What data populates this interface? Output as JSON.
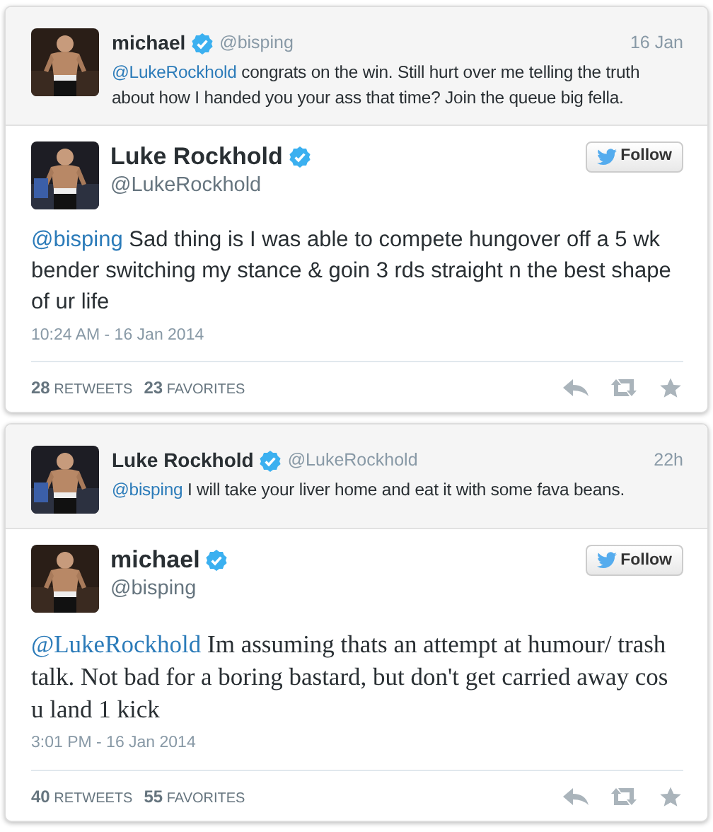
{
  "tweets": [
    {
      "reply_to": {
        "name": "michael",
        "verified": true,
        "handle": "@bisping",
        "time": "16 Jan",
        "mention": "@LukeRockhold",
        "text": " congrats on the win. Still hurt over me telling the truth about how I handed you your ass that time? Join the queue big fella."
      },
      "author": {
        "name": "Luke Rockhold",
        "verified": true,
        "handle": "@LukeRockhold"
      },
      "follow": {
        "label": "Follow"
      },
      "kind": "sans",
      "mention": "@bisping",
      "text": " Sad thing is I was able to compete hungover off a 5 wk bender switching my stance & goin 3 rds straight n the best shape of ur life",
      "timestamp": "10:24 AM - 16 Jan 2014",
      "stats": [
        {
          "count": "28",
          "label": "RETWEETS"
        },
        {
          "count": "23",
          "label": "FAVORITES"
        }
      ]
    },
    {
      "reply_to": {
        "name": "Luke Rockhold",
        "verified": true,
        "handle": "@LukeRockhold",
        "time": "22h",
        "mention": "@bisping",
        "text": " I will take your liver home and eat it with some fava beans."
      },
      "author": {
        "name": "michael",
        "verified": true,
        "handle": "@bisping"
      },
      "follow": {
        "label": "Follow"
      },
      "kind": "serif",
      "mention": "@LukeRockhold",
      "text": " Im assuming thats an attempt at humour/ trash talk. Not bad for a boring bastard, but don't get carried away cos u land 1 kick",
      "timestamp": "3:01 PM - 16 Jan 2014",
      "stats": [
        {
          "count": "40",
          "label": "RETWEETS"
        },
        {
          "count": "55",
          "label": "FAVORITES"
        }
      ]
    }
  ]
}
